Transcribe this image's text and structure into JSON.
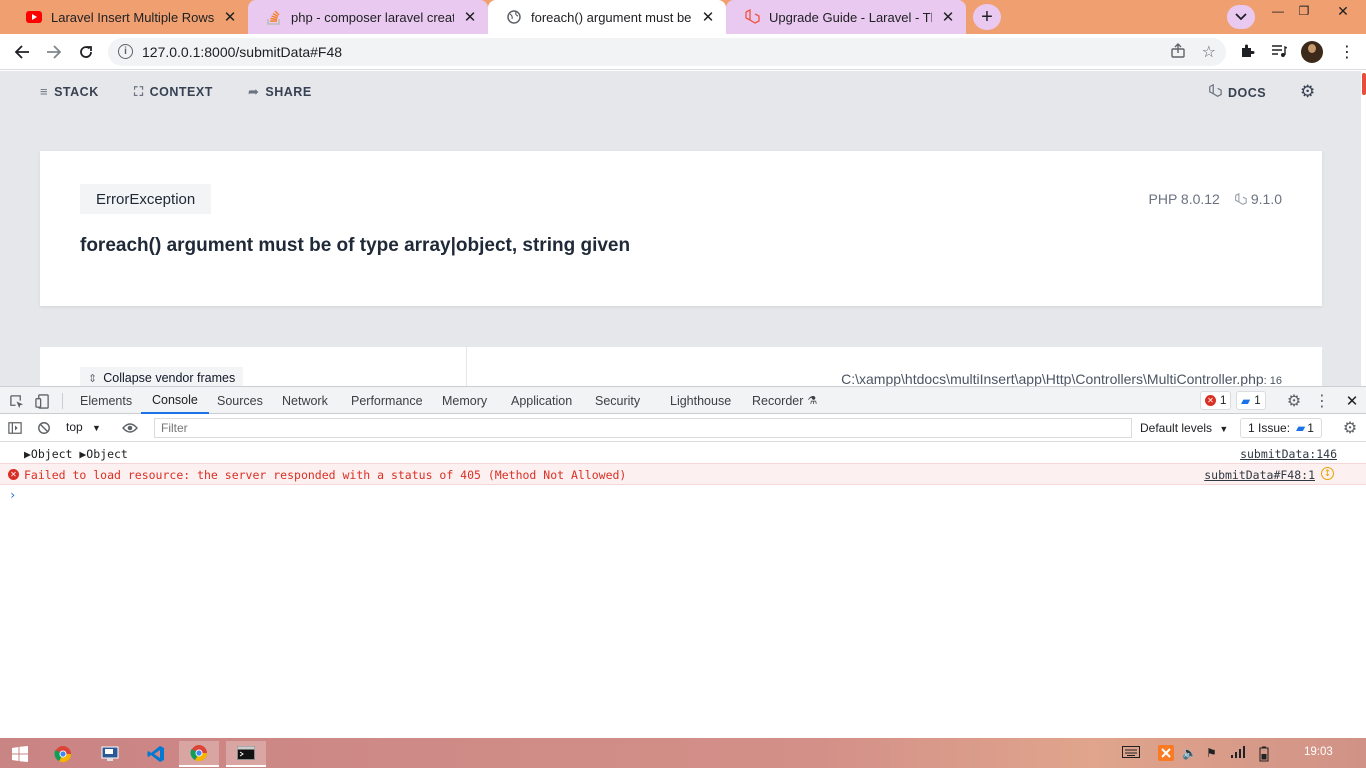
{
  "browser": {
    "tabs": [
      {
        "title": "Laravel Insert Multiple Rows in d",
        "favicon": "youtube-icon",
        "state": "inactive"
      },
      {
        "title": "php - composer laravel create pr",
        "favicon": "stackoverflow-icon",
        "state": "inactive"
      },
      {
        "title": "foreach() argument must be of ty",
        "favicon": "globe-icon",
        "state": "active"
      },
      {
        "title": "Upgrade Guide - Laravel - The PH",
        "favicon": "laravel-icon",
        "state": "inactive"
      }
    ],
    "url": "127.0.0.1:8000/submitData#F48"
  },
  "ignition": {
    "nav": {
      "stack": "STACK",
      "context": "CONTEXT",
      "share": "SHARE",
      "docs": "DOCS"
    },
    "exception_class": "ErrorException",
    "php_version": "PHP 8.0.12",
    "laravel_version": "9.1.0",
    "message": "foreach() argument must be of type array|object, string given",
    "collapse_label": "Collapse vendor frames",
    "file_path": "C:\\xampp\\htdocs\\multiInsert\\app\\Http\\Controllers\\MultiController.php",
    "file_line": ": 16"
  },
  "devtools": {
    "tabs": [
      "Elements",
      "Console",
      "Sources",
      "Network",
      "Performance",
      "Memory",
      "Application",
      "Security",
      "Lighthouse",
      "Recorder"
    ],
    "active_tab": "Console",
    "error_count": "1",
    "message_count": "1",
    "context": "top",
    "filter_placeholder": "Filter",
    "levels": "Default levels",
    "issues_label": "1 Issue:",
    "issues_count": "1",
    "logs": [
      {
        "text": "▶Object ▶Object",
        "source": "submitData:146",
        "level": "log"
      },
      {
        "text": "Failed to load resource: the server responded with a status of 405 (Method Not Allowed)",
        "source": "submitData#F48:1",
        "level": "error"
      }
    ]
  },
  "taskbar": {
    "clock": "19:03"
  }
}
